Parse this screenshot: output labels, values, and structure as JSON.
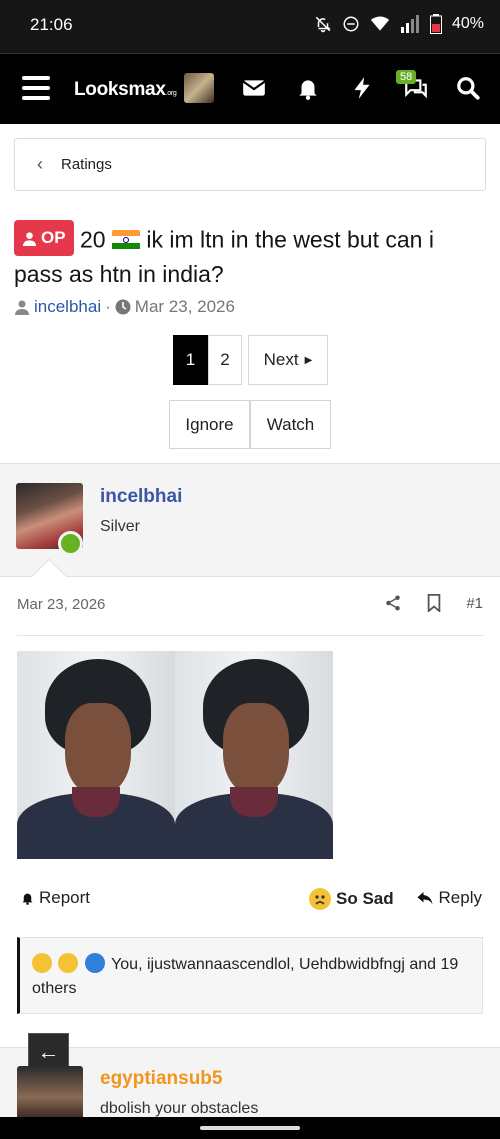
{
  "status_bar": {
    "time": "21:06",
    "battery": "40%",
    "icons": [
      "bell-off-icon",
      "do-not-disturb-icon",
      "wifi-icon",
      "signal-icon",
      "battery-icon"
    ]
  },
  "top_nav": {
    "logo_text": "Looksmax",
    "logo_suffix": ".org",
    "conversations_badge": "58",
    "icons": [
      "menu-icon",
      "mail-icon",
      "bell-icon",
      "bolt-icon",
      "chat-icon",
      "search-icon"
    ]
  },
  "breadcrumb": {
    "label": "Ratings"
  },
  "thread": {
    "prefix_badge": "OP",
    "age": "20",
    "title": "ik im ltn in the west but can i pass as htn in india?",
    "author": "incelbhai",
    "separator": "·",
    "date": "Mar 23, 2026"
  },
  "pagination": {
    "current": "1",
    "page2": "2",
    "next_label": "Next"
  },
  "thread_actions": {
    "ignore": "Ignore",
    "watch": "Watch"
  },
  "post": {
    "author": "incelbhai",
    "rank": "Silver",
    "date": "Mar 23, 2026",
    "number": "#1"
  },
  "post_footer": {
    "report": "Report",
    "reaction": "So Sad",
    "reply": "Reply"
  },
  "reactions_summary": {
    "text": "You, ijustwannaascendlol, Uehdbwidbfngj and 19 others"
  },
  "next_post": {
    "author": "egyptiansub5",
    "subtitle": "dbolish your obstacles"
  },
  "colors": {
    "accent_blue": "#3b55a8",
    "op_badge": "#e5394b",
    "online": "#66b31f",
    "next_author": "#f0951e"
  }
}
